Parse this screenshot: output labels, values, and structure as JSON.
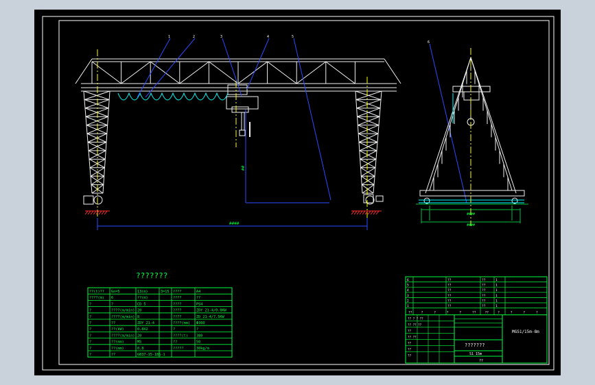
{
  "drawing": {
    "title": "???????",
    "model": "MGS1/15m-8m",
    "name_box": "???????",
    "scale_text": "S1 15m",
    "bottom_note": "??",
    "dim_span": "####",
    "dim_height": "##",
    "dim_base1": "####",
    "dim_base2": "####",
    "callouts": [
      "1",
      "2",
      "3",
      "4",
      "5",
      "6"
    ]
  },
  "spec_table": {
    "rows": [
      [
        "??(t)??",
        "Gn=5",
        "13(m)",
        "3=15",
        "????",
        "A4"
      ],
      [
        "????(m)",
        "6",
        "??(m)",
        "",
        "????",
        "??"
      ],
      [
        "?",
        "?",
        "CD 5",
        "",
        "????",
        "PS4"
      ],
      [
        "?",
        "????(m/min)",
        "20",
        "",
        "????",
        "ZDY 21-4/0.8KW"
      ],
      [
        "?",
        "????(m/min)",
        "8",
        "",
        "????",
        "ZD 21-4/7.5KW"
      ],
      [
        "?",
        "??",
        "ZDY 21-4",
        "",
        "????(mm)",
        "Φ300"
      ],
      [
        "?",
        "??(kW)",
        "0.8X2",
        "",
        "?",
        "?"
      ],
      [
        "?",
        "????(m/min)",
        "20",
        "",
        "????(t)",
        "380"
      ],
      [
        "?",
        "??(mm)",
        "M5",
        "",
        "??",
        "50"
      ],
      [
        "?",
        "??(mm)",
        "0.8",
        "",
        "?????",
        "30kg/m"
      ],
      [
        "?",
        "??",
        "GB37-15-1B5-1",
        "",
        "",
        ""
      ]
    ]
  },
  "title_block": {
    "parts": [
      [
        "6",
        "",
        "??",
        "??",
        "1",
        ""
      ],
      [
        "5",
        "",
        "??",
        "??",
        "1",
        ""
      ],
      [
        "4",
        "",
        "??",
        "??",
        "1",
        ""
      ],
      [
        "3",
        "",
        "??",
        "??",
        "1",
        ""
      ],
      [
        "2",
        "",
        "??",
        "??",
        "1",
        ""
      ],
      [
        "1",
        "",
        "??",
        "??",
        "1",
        ""
      ]
    ],
    "header": [
      "??",
      "?",
      "?",
      "?",
      "?",
      "??",
      "??",
      "?",
      "?",
      "?",
      "?"
    ],
    "grid_labels": [
      "?? ? ? ??",
      "?? ?? ??",
      "??",
      "?? ??",
      "??",
      "??",
      "??"
    ]
  }
}
